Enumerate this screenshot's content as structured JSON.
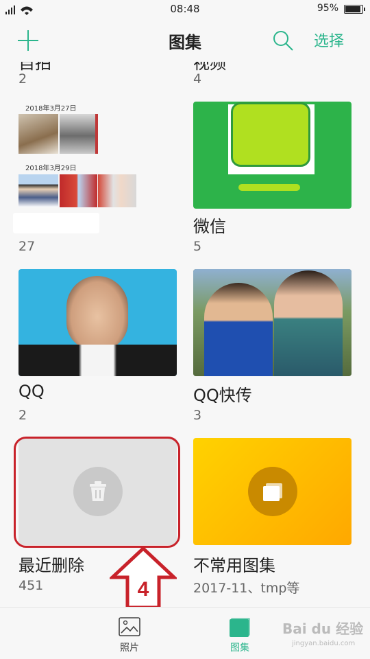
{
  "status": {
    "time": "08:48",
    "battery": "95%"
  },
  "header": {
    "title": "图集",
    "select_label": "选择"
  },
  "albums": [
    {
      "label": "自拍",
      "count": "2"
    },
    {
      "label": "视频",
      "count": "4"
    },
    {
      "label": "",
      "count": "27",
      "dates": [
        "2018年3月27日",
        "2018年3月29日"
      ]
    },
    {
      "label": "微信",
      "count": "5"
    },
    {
      "label": "QQ",
      "count": "2"
    },
    {
      "label": "QQ快传",
      "count": "3"
    },
    {
      "label": "最近删除",
      "count": "451"
    },
    {
      "label": "不常用图集",
      "count": "2017-11、tmp等"
    }
  ],
  "annotation": {
    "step": "4"
  },
  "tabs": [
    {
      "label": "照片"
    },
    {
      "label": "图集"
    }
  ],
  "watermark": {
    "text": "Bai du 经验",
    "sub": "jingyan.baidu.com"
  }
}
